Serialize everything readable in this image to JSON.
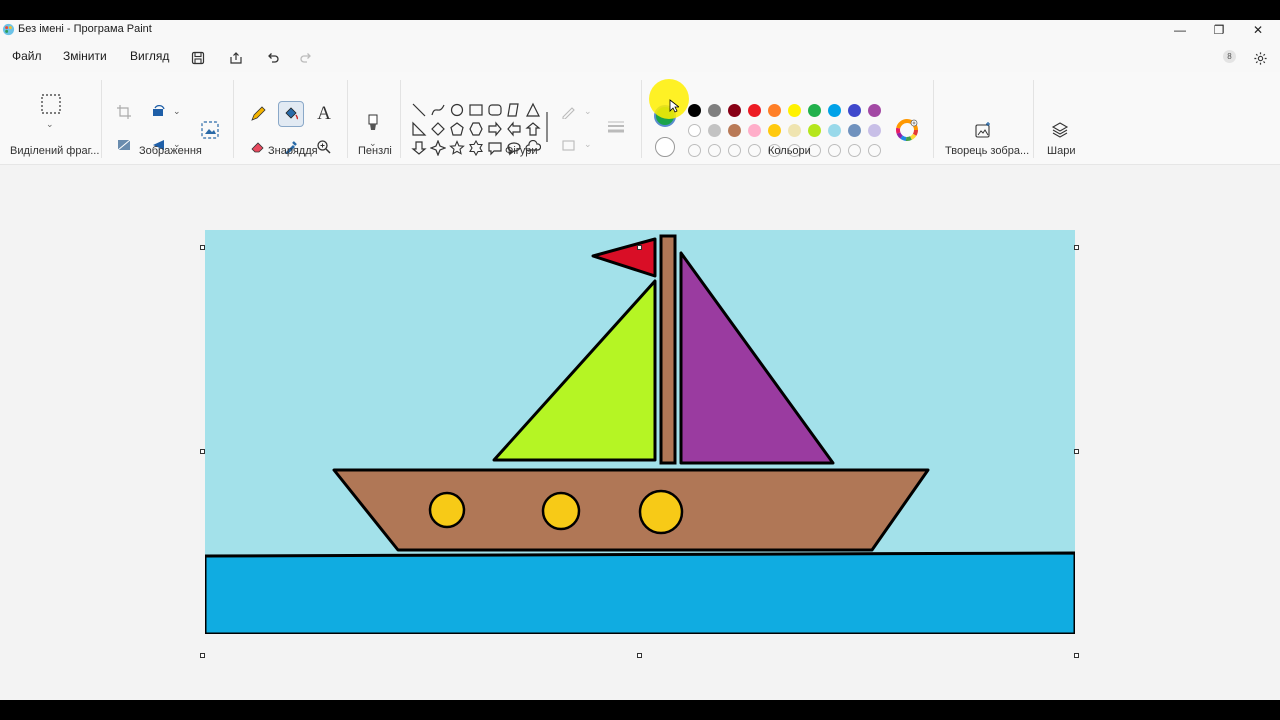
{
  "window": {
    "title": "Без імені - Програма Paint",
    "controls": {
      "minimize": "—",
      "restore": "❐",
      "close": "✕"
    }
  },
  "menu": {
    "file": "Файл",
    "edit": "Змінити",
    "view": "Вигляд"
  },
  "account_badge": "8",
  "ribbon": {
    "groups": {
      "selection": "Виділений фраг...",
      "image": "Зображення",
      "tools": "Знаряддя",
      "brushes": "Пензлі",
      "shapes": "Фігури",
      "colors": "Кольори",
      "image_creator": "Творець зобра...",
      "layers": "Шари"
    },
    "text_tool_glyph": "A",
    "selected_tool": "fill-bucket",
    "colors": {
      "primary": "#1ba34a",
      "secondary": "#ffffff",
      "row1": [
        "#000000",
        "#7f7f7f",
        "#880015",
        "#ed1c24",
        "#ff7f27",
        "#fff200",
        "#22b14c",
        "#00a2e8",
        "#3f48cc",
        "#a349a4"
      ],
      "row2": [
        "#ffffff",
        "#c3c3c3",
        "#b97a57",
        "#ffaec9",
        "#ffc90e",
        "#efe4b0",
        "#b5e61d",
        "#99d9ea",
        "#7092be",
        "#c8bfe7"
      ]
    }
  },
  "drawing": {
    "sky": "#a3e1ea",
    "sea": "#10ace1",
    "hull": "#b07756",
    "mast": "#b07756",
    "left_sail": "#b5f524",
    "right_sail": "#9a3ba0",
    "flag": "#d90e26",
    "portholes": "#f7ca17"
  }
}
